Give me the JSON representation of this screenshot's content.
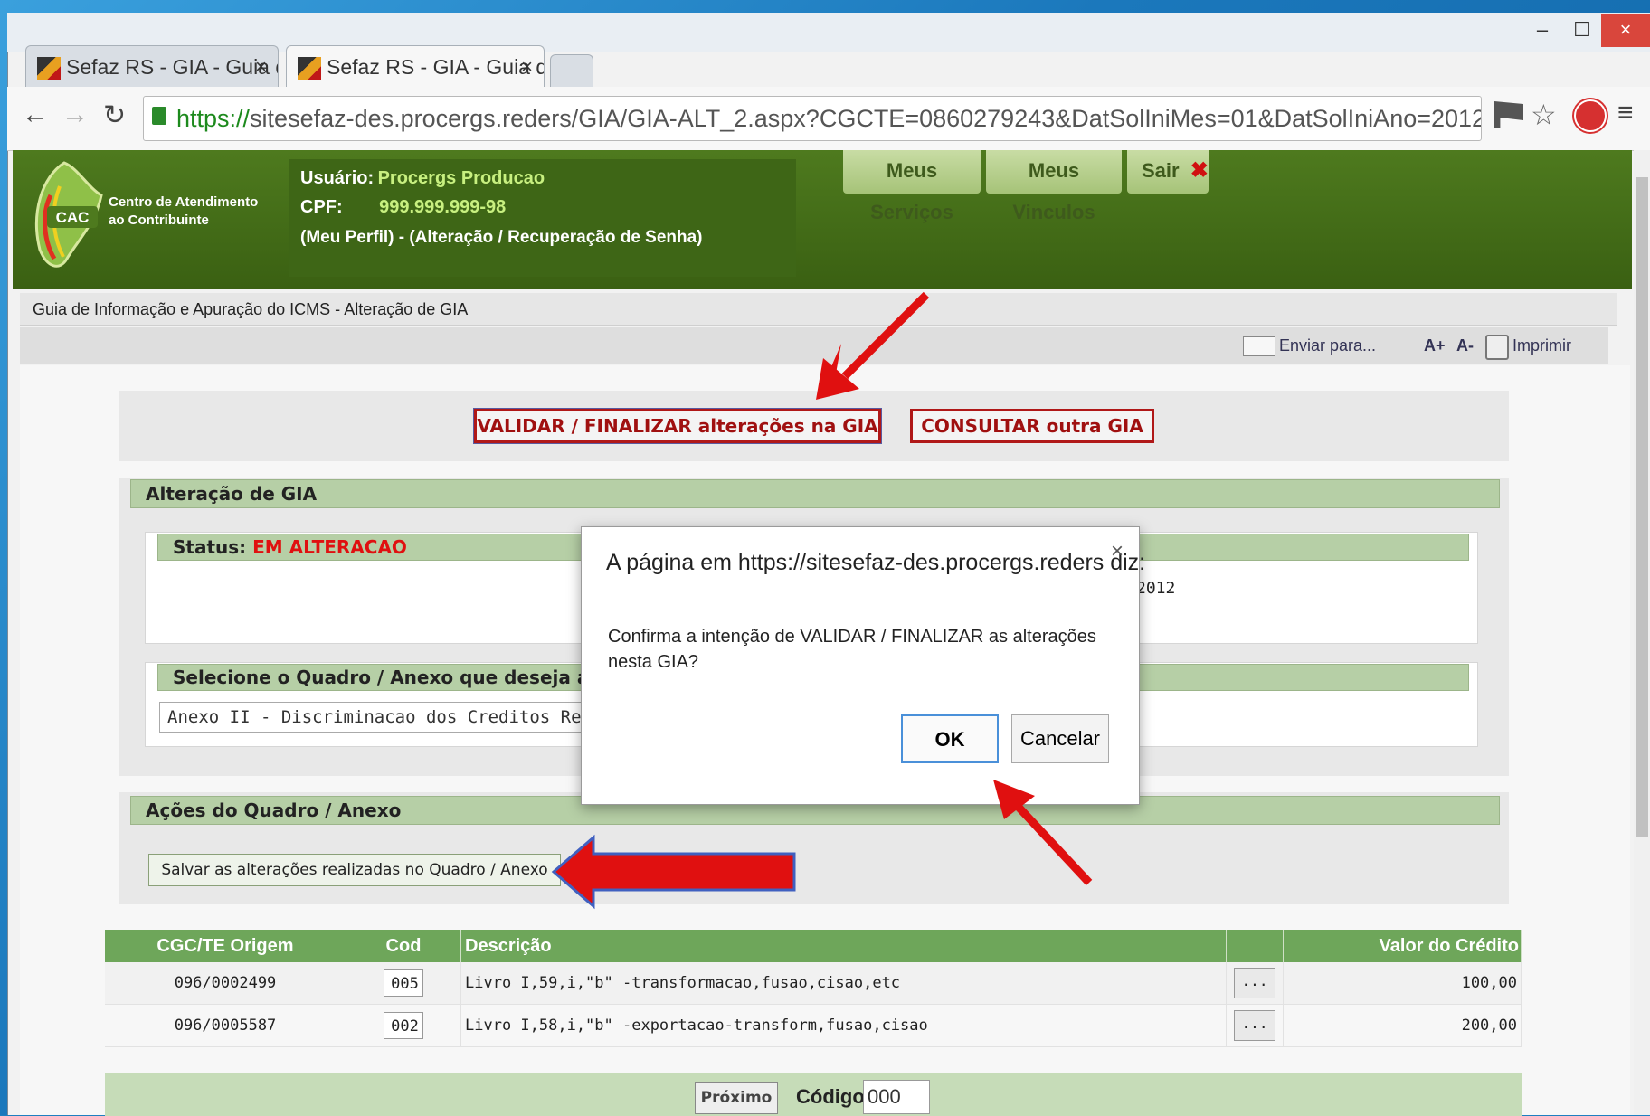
{
  "browser": {
    "tabs": [
      {
        "title": "Sefaz RS - GIA - Guia de In",
        "close": "×"
      },
      {
        "title": "Sefaz RS - GIA - Guia de In",
        "close": "×"
      }
    ],
    "url_scheme": "https://",
    "url_rest": "sitesefaz-des.procergs.reders/GIA/GIA-ALT_2.aspx?CGCTE=0860279243&DatSolIniMes=01&DatSolIniAno=2012",
    "win_minimize": "‒",
    "win_maximize": "☐",
    "win_close": "×"
  },
  "header": {
    "cac_logo_text": "CAC",
    "cac_line1": "Centro de Atendimento",
    "cac_line2": "ao Contribuinte",
    "user_label": "Usuário:",
    "user_value": "Procergs Producao",
    "cpf_label": "CPF:",
    "cpf_value": "999.999.999-98",
    "profile_links": "(Meu Perfil) - (Alteração / Recuperação de Senha)",
    "btn_services": "Meus Serviços",
    "btn_links": "Meus Vinculos",
    "btn_exit": "Sair",
    "exit_icon": "✖"
  },
  "breadcrumb": "Guia de Informação e Apuração do ICMS - Alteração de GIA",
  "tools": {
    "send": "Enviar para...",
    "font_up": "A+",
    "font_down": "A-",
    "print": "Imprimir"
  },
  "actions": {
    "validate": "VALIDAR / FINALIZAR alterações na GIA",
    "consult": "CONSULTAR outra GIA"
  },
  "section_alter": {
    "title": "Alteração de GIA",
    "status_label": "Status:",
    "status_value": "EM ALTERACAO",
    "status_partial": "2012",
    "select_title": "Selecione o Quadro / Anexo que deseja altera",
    "select_value": "Anexo II - Discriminacao dos Creditos Recebidos por"
  },
  "section_actions": {
    "title": "Ações do Quadro / Anexo",
    "save_button": "Salvar as alterações realizadas no Quadro / Anexo"
  },
  "table": {
    "headers": [
      "CGC/TE Origem",
      "Cod",
      "Descrição",
      "",
      "Valor do Crédito"
    ],
    "rows": [
      {
        "origem": "096/0002499",
        "cod": "005",
        "desc": "Livro I,59,i,\"b\" -transformacao,fusao,cisao,etc",
        "btn": "...",
        "valor": "100,00"
      },
      {
        "origem": "096/0005587",
        "cod": "002",
        "desc": "Livro I,58,i,\"b\" -exportacao-transform,fusao,cisao",
        "btn": "...",
        "valor": "200,00"
      }
    ]
  },
  "footer": {
    "next_button": "Próximo",
    "code_label": "Código",
    "code_value": "000"
  },
  "dialog": {
    "title": "A página em https://sitesefaz-des.procergs.reders diz:",
    "close": "×",
    "message": "Confirma a intenção de VALIDAR / FINALIZAR as alterações nesta GIA?",
    "ok": "OK",
    "cancel": "Cancelar"
  },
  "colors": {
    "header_green": "#4e7a1e",
    "annotation_red": "#e01010",
    "status_red": "#e01010"
  }
}
